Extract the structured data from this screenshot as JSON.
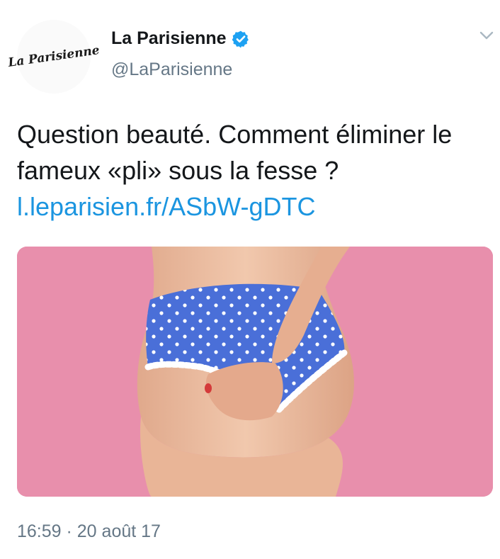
{
  "account": {
    "avatar_text": "La Parisienne",
    "display_name": "La Parisienne",
    "handle": "@LaParisienne",
    "verified": true
  },
  "menu_icon": "chevron-down-icon",
  "tweet": {
    "text": "Question beauté. Comment éliminer le fameux «pli» sous la fesse ? ",
    "link": "l.leparisien.fr/ASbW-gDTC",
    "time": "16:59",
    "separator": " · ",
    "date": "20 août 17"
  },
  "colors": {
    "link": "#1b95e0",
    "verified": "#1da1f2",
    "secondary_text": "#657786",
    "photo_background": "#e88fac",
    "underwear": "#4a6fd8"
  }
}
